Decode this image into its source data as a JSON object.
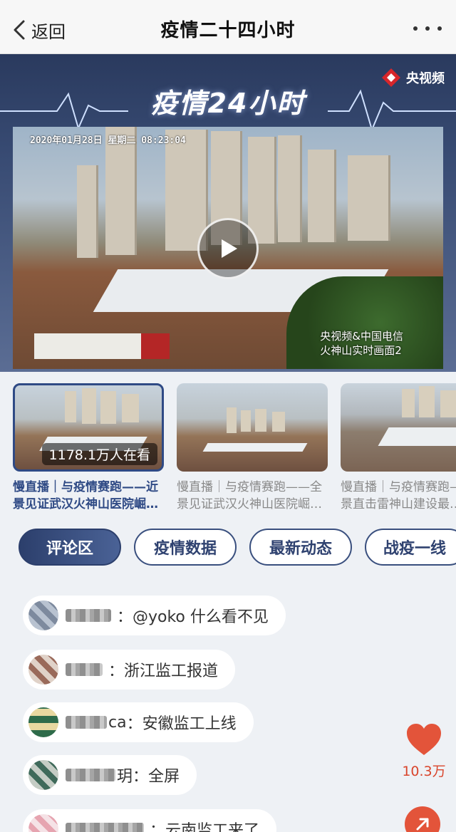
{
  "nav": {
    "back_label": "返回",
    "title": "疫情二十四小时"
  },
  "hero": {
    "banner_title": "疫情24小时",
    "brand": "央视频",
    "video_timestamp": "2020年01月28日  星期二  08:23:04",
    "video_caption_line1": "央视频&中国电信",
    "video_caption_line2": "火神山实时画面2"
  },
  "thumbnails": [
    {
      "title": "慢直播｜与疫情赛跑——近景见证武汉火神山医院崛…",
      "viewers": "1178.1万人在看",
      "active": true
    },
    {
      "title": "慢直播｜与疫情赛跑——全景见证武汉火神山医院崛…",
      "active": false
    },
    {
      "title": "慢直播｜与疫情赛跑——全景直击雷神山建设最…",
      "active": false
    }
  ],
  "tabs": [
    "评论区",
    "疫情数据",
    "最新动态",
    "战疫一线"
  ],
  "comments": [
    {
      "name_suffix": "",
      "text": "：@yoko 什么看不见"
    },
    {
      "name_suffix": "",
      "text": "：浙江监工报道"
    },
    {
      "name_suffix": "ca",
      "text": "：安徽监工上线"
    },
    {
      "name_suffix": "玥",
      "text": "：全屏"
    },
    {
      "name_suffix": "",
      "text": "：云南监工来了"
    }
  ],
  "like": {
    "count": "10.3万"
  },
  "colors": {
    "accent": "#2f4a85",
    "like": "#e3543a"
  }
}
